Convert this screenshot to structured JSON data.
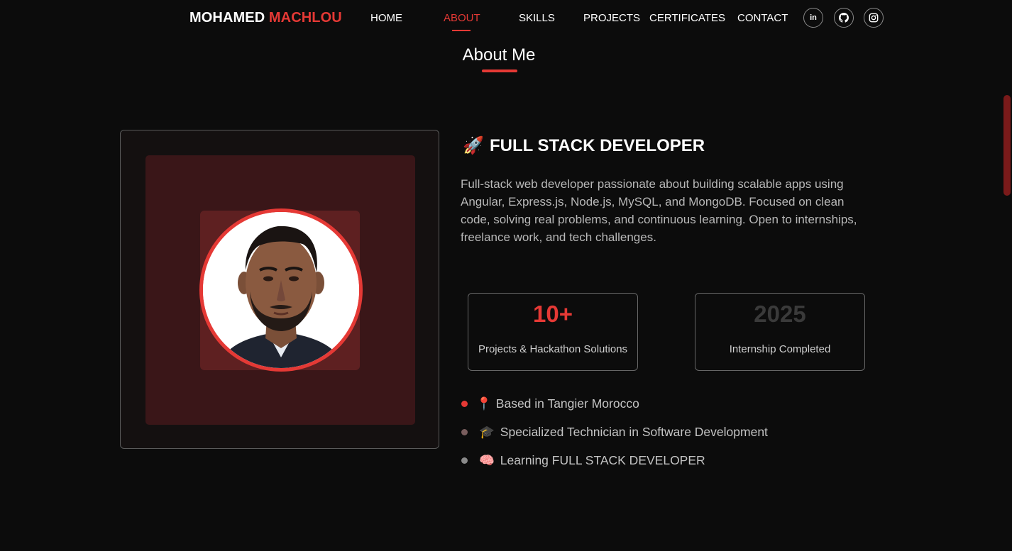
{
  "brand": {
    "first": "MOHAMED",
    "last": "MACHLOU",
    "accent": "#e53935"
  },
  "nav": {
    "items": [
      "HOME",
      "ABOUT",
      "SKILLS",
      "PROJECTS",
      "CERTIFICATES",
      "CONTACT"
    ],
    "active": "ABOUT"
  },
  "social": [
    {
      "name": "linkedin",
      "icon": "linkedin-icon",
      "glyph": "in"
    },
    {
      "name": "github",
      "icon": "github-icon"
    },
    {
      "name": "instagram",
      "icon": "instagram-icon"
    }
  ],
  "about": {
    "title": "About Me",
    "role_icon": "🚀",
    "role": "FULL STACK DEVELOPER",
    "bio": "Full-stack web developer passionate about building scalable apps using Angular, Express.js, Node.js, MySQL, and MongoDB. Focused on clean code, solving real problems, and continuous learning. Open to internships, freelance work, and tech challenges."
  },
  "stats": [
    {
      "value": "10+",
      "label": "Projects & Hackathon Solutions",
      "color": "#e53935"
    },
    {
      "value": "2025",
      "label": "Internship Completed",
      "color": "#3a3a3a"
    }
  ],
  "facts": [
    {
      "emoji": "📍",
      "text": "Based in Tangier Morocco",
      "dot_color": "#e53935"
    },
    {
      "emoji": "🎓",
      "text": "Specialized Technician in Software Development",
      "dot_color": "#7a5e5e"
    },
    {
      "emoji": "🧠",
      "text": "Learning FULL STACK DEVELOPER",
      "dot_color": "#8a8a8a"
    }
  ]
}
